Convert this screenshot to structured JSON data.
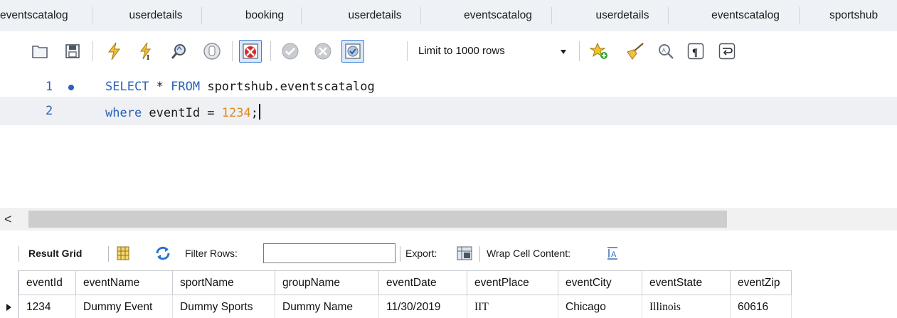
{
  "tabs": [
    {
      "label": "eventscatalog"
    },
    {
      "label": "userdetails"
    },
    {
      "label": "booking"
    },
    {
      "label": "userdetails"
    },
    {
      "label": "eventscatalog"
    },
    {
      "label": "userdetails"
    },
    {
      "label": "eventscatalog"
    },
    {
      "label": "sportshub"
    }
  ],
  "toolbar": {
    "limit_select": "Limit to 1000 rows",
    "icons": [
      "open-file-icon",
      "save-icon",
      "execute-icon",
      "execute-current-icon",
      "explain-icon",
      "stop-icon",
      "toggle-stop-on-error-icon",
      "commit-icon",
      "rollback-icon",
      "toggle-autocommit-icon",
      "beautify-icon",
      "sweep-icon",
      "find-replace-icon",
      "invisible-chars-icon",
      "wrap-lines-icon"
    ]
  },
  "editor": {
    "lines": [
      {
        "number": "1",
        "tokens": [
          {
            "t": "SELECT",
            "c": "kw"
          },
          {
            "t": " * ",
            "c": "id"
          },
          {
            "t": "FROM",
            "c": "kw"
          },
          {
            "t": " sportshub.eventscatalog",
            "c": "id"
          }
        ]
      },
      {
        "number": "2",
        "tokens": [
          {
            "t": "where",
            "c": "kw"
          },
          {
            "t": " eventId = ",
            "c": "id"
          },
          {
            "t": "1234",
            "c": "num"
          },
          {
            "t": ";",
            "c": "id"
          }
        ]
      }
    ]
  },
  "scrollbar": {
    "left_arrow": "<"
  },
  "result_toolbar": {
    "result_grid": "Result Grid",
    "filter_rows": "Filter Rows:",
    "filter_value": "",
    "export": "Export:",
    "wrap_cell": "Wrap Cell Content:"
  },
  "grid": {
    "columns": [
      "eventId",
      "eventName",
      "sportName",
      "groupName",
      "eventDate",
      "eventPlace",
      "eventCity",
      "eventState",
      "eventZip"
    ],
    "rows": [
      [
        "1234",
        "Dummy Event",
        "Dummy Sports",
        "Dummy Name",
        "11/30/2019",
        "IIT",
        "Chicago",
        "Illinois",
        "60616"
      ]
    ]
  }
}
